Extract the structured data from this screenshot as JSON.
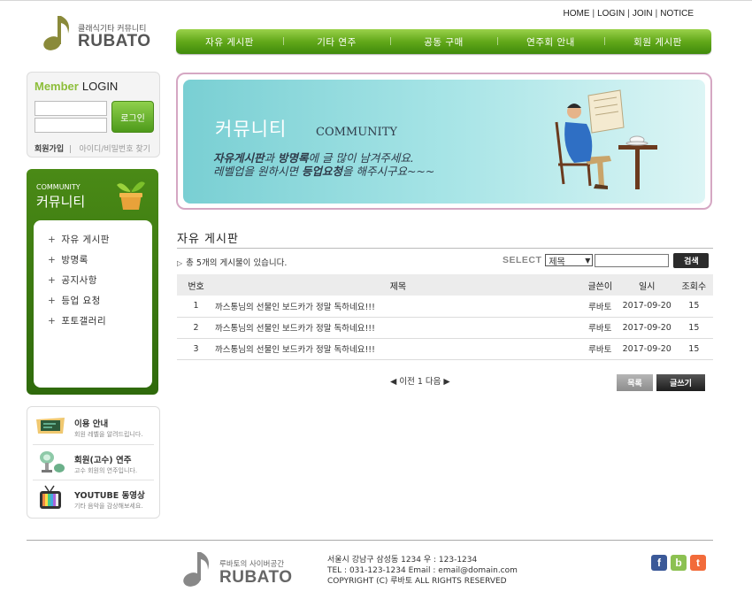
{
  "brand": {
    "tagline": "클래식기타 커뮤니티",
    "name": "RUBATO"
  },
  "util_nav": [
    "HOME",
    "LOGIN",
    "JOIN",
    "NOTICE"
  ],
  "main_nav": [
    "자유 게시판",
    "기타 연주",
    "공동 구매",
    "연주회 안내",
    "회원 게시판"
  ],
  "login": {
    "title_accent": "Member",
    "title": "LOGIN",
    "button": "로그인",
    "join": "회원가입",
    "find": "아이디/비밀번호 찾기"
  },
  "community": {
    "en": "COMMUNITY",
    "ko": "커뮤니티",
    "items": [
      "자유 게시판",
      "방명록",
      "공지사항",
      "등업 요청",
      "포토갤러리"
    ]
  },
  "info": [
    {
      "title": "이용 안내",
      "sub": "회원 레벨을 알려드립니다.",
      "icon": "chalkboard-icon"
    },
    {
      "title": "회원(고수) 연주",
      "sub": "고수 회원의 연주입니다.",
      "icon": "spotlight-icon"
    },
    {
      "title": "YOUTUBE 동영상",
      "sub": "기타 음악을 감상해보세요.",
      "icon": "tv-icon"
    }
  ],
  "banner": {
    "title_ko": "커뮤니티",
    "title_en": "COMMUNITY",
    "line1_a": "자유게시판",
    "line1_b": "과 ",
    "line1_c": "방명록",
    "line1_d": "에 글 많이 남겨주세요.",
    "line2_a": "레벨업을 원하시면 ",
    "line2_b": "등업요청",
    "line2_c": "을 해주시구요~~~"
  },
  "board": {
    "title": "자유 게시판",
    "count_text": "총 5개의 게시물이 있습니다.",
    "search_label": "SELECT",
    "search_option": "제목",
    "search_button": "검색",
    "columns": [
      "번호",
      "제목",
      "글쓴이",
      "일시",
      "조회수"
    ],
    "rows": [
      {
        "no": "1",
        "title": "까스통님의 선물인 보드카가 정말 독하네요!!!",
        "author": "루바토",
        "date": "2017-09-20",
        "views": "15"
      },
      {
        "no": "2",
        "title": "까스통님의 선물인 보드카가 정말 독하네요!!!",
        "author": "루바토",
        "date": "2017-09-20",
        "views": "15"
      },
      {
        "no": "3",
        "title": "까스통님의 선물인 보드카가 정말 독하네요!!!",
        "author": "루바토",
        "date": "2017-09-20",
        "views": "15"
      }
    ],
    "paging": "◀ 이전 1 다음 ▶",
    "list_button": "목록",
    "write_button": "글쓰기"
  },
  "footer": {
    "tagline": "루바토의 사이버공간",
    "name": "RUBATO",
    "address": "서울시 강남구 삼성동 1234 우 : 123-1234",
    "contact": "TEL : 031-123-1234 Email : email@domain.com",
    "copyright": "COPYRIGHT (C) 루바토 ALL RIGHTS RESERVED",
    "social": [
      {
        "letter": "f",
        "color": "#3b5998",
        "icon": "facebook-icon"
      },
      {
        "letter": "b",
        "color": "#8cc152",
        "icon": "blog-icon"
      },
      {
        "letter": "t",
        "color": "#f26b3a",
        "icon": "twitter-icon"
      }
    ]
  },
  "colors": {
    "accent_green": "#62a81a",
    "dark_green": "#3c7a12",
    "banner_border": "#d5a7c3"
  }
}
